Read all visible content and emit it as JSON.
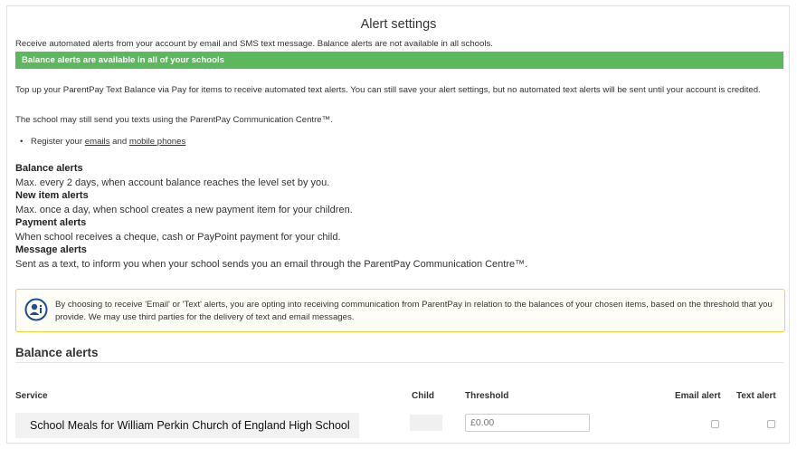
{
  "page": {
    "title": "Alert settings",
    "intro": "Receive automated alerts from your account by email and SMS text message. Balance alerts are not available in all schools.",
    "banner": "Balance alerts are available in all of your schools",
    "topup_text": "Top up your ParentPay Text Balance via Pay for items to receive automated text alerts. You can still save your alert settings, but no automated text alerts will be sent until your account is credited.",
    "school_text": "The school may still send you texts using the ParentPay Communication Centre™.",
    "register": {
      "bullet": "•",
      "prefix": "Register your",
      "emails_link": "emails",
      "and": "and",
      "phones_link": "mobile phones"
    }
  },
  "alert_types": [
    {
      "heading": "Balance alerts",
      "description": "Max. every 2 days, when account balance reaches the level set by you."
    },
    {
      "heading": "New item alerts",
      "description": "Max. once a day, when school creates a new payment item for your children."
    },
    {
      "heading": "Payment alerts",
      "description": "When school receives a cheque, cash or PayPoint payment for your child."
    },
    {
      "heading": "Message alerts",
      "description": "Sent as a text, to inform you when your school sends you an email through the ParentPay Communication Centre™."
    }
  ],
  "notice": {
    "icon": "person-info-icon",
    "text": "By choosing to receive 'Email' or 'Text' alerts, you are opting into receiving communication from ParentPay in relation to the balances of your chosen items, based on the threshold that you provide. We may use third parties for the delivery of text and email messages."
  },
  "balance_section": {
    "title": "Balance alerts",
    "columns": {
      "service": "Service",
      "child": "Child",
      "threshold": "Threshold",
      "email": "Email alert",
      "text": "Text alert"
    },
    "rows": [
      {
        "service": "School Meals for William Perkin Church of England High School",
        "child": "",
        "threshold_placeholder": "£0.00",
        "email_checked": false,
        "text_checked": false
      }
    ]
  },
  "colors": {
    "banner": "#5cb85c",
    "notice_border": "#f0d43a",
    "notice_icon": "#1b4f8a"
  }
}
